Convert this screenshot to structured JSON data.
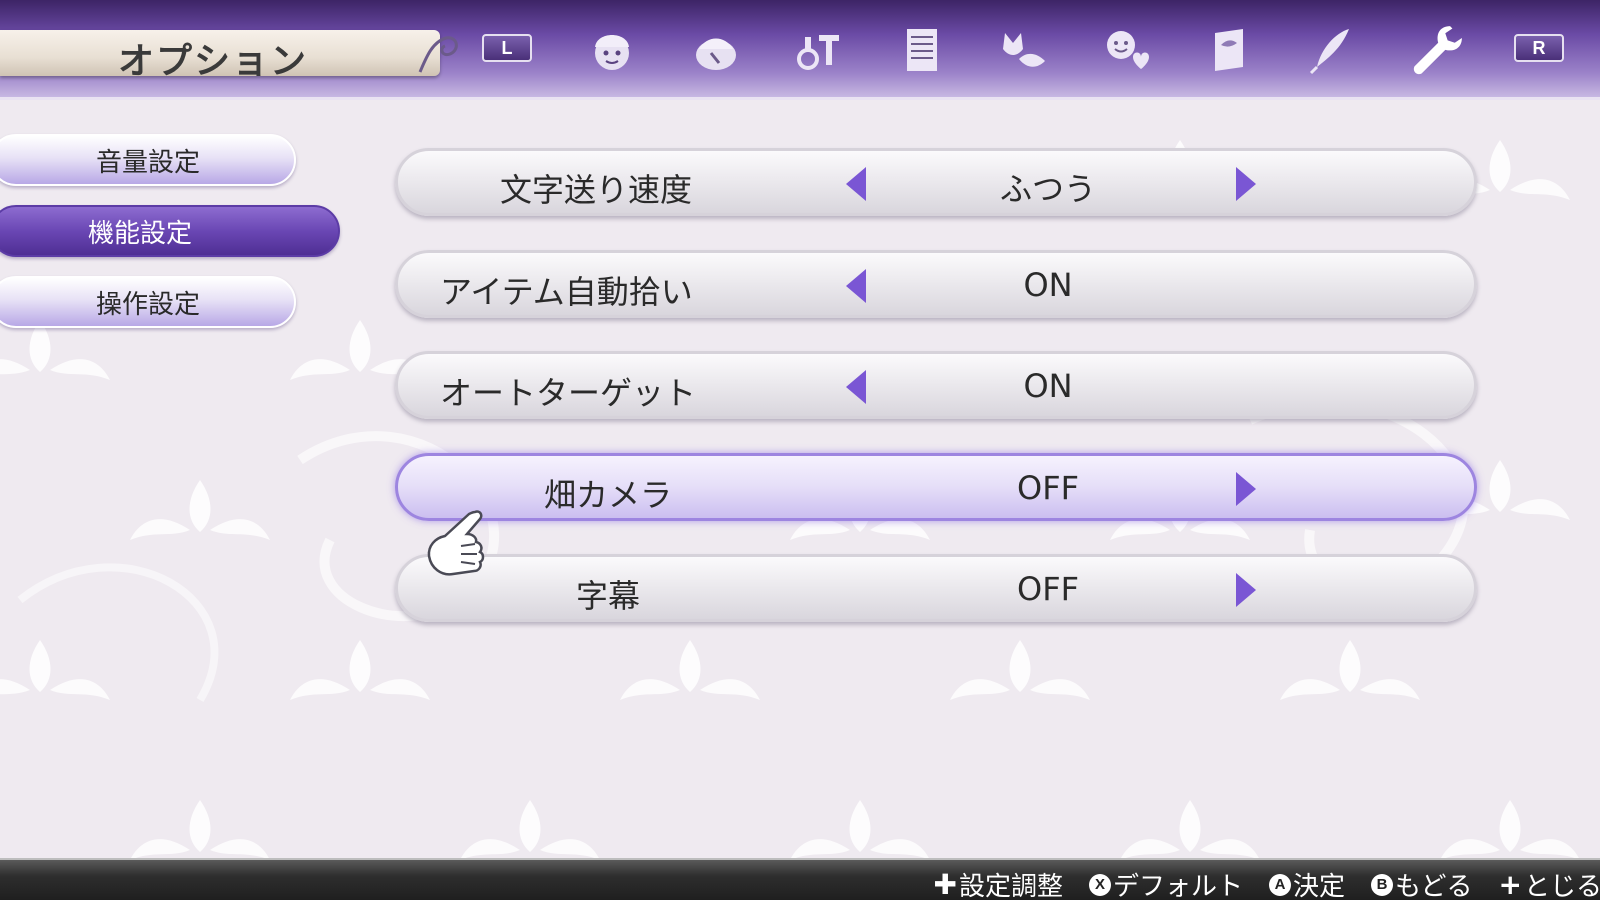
{
  "header": {
    "title": "オプション",
    "left_shoulder": "L",
    "right_shoulder": "R",
    "tab_icons": [
      "character-face-icon",
      "pouch-icon",
      "alchemy-flask-icon",
      "document-list-icon",
      "animal-handshake-icon",
      "smile-heart-icon",
      "book-icon",
      "quill-icon",
      "wrench-icon"
    ]
  },
  "categories": [
    {
      "label": "音量設定",
      "active": false
    },
    {
      "label": "機能設定",
      "active": true
    },
    {
      "label": "操作設定",
      "active": false
    }
  ],
  "options": [
    {
      "label": "文字送り速度",
      "value": "ふつう",
      "left_arrow": true,
      "right_arrow": true,
      "selected": false
    },
    {
      "label": "アイテム自動拾い",
      "value": "ON",
      "left_arrow": true,
      "right_arrow": false,
      "selected": false
    },
    {
      "label": "オートターゲット",
      "value": "ON",
      "left_arrow": true,
      "right_arrow": false,
      "selected": false
    },
    {
      "label": "畑カメラ",
      "value": "OFF",
      "left_arrow": false,
      "right_arrow": true,
      "selected": true
    },
    {
      "label": "字幕",
      "value": "OFF",
      "left_arrow": false,
      "right_arrow": true,
      "selected": false
    }
  ],
  "footer": {
    "hints": [
      {
        "glyph": "✚",
        "label": "設定調整"
      },
      {
        "glyph": "X",
        "label": "デフォルト"
      },
      {
        "glyph": "A",
        "label": "決定"
      },
      {
        "glyph": "B",
        "label": "もどる"
      },
      {
        "glyph": "+",
        "label": "とじる"
      }
    ]
  },
  "colors": {
    "accent": "#6a47b4",
    "arrow": "#7a56d4",
    "background": "#efeaf0"
  }
}
